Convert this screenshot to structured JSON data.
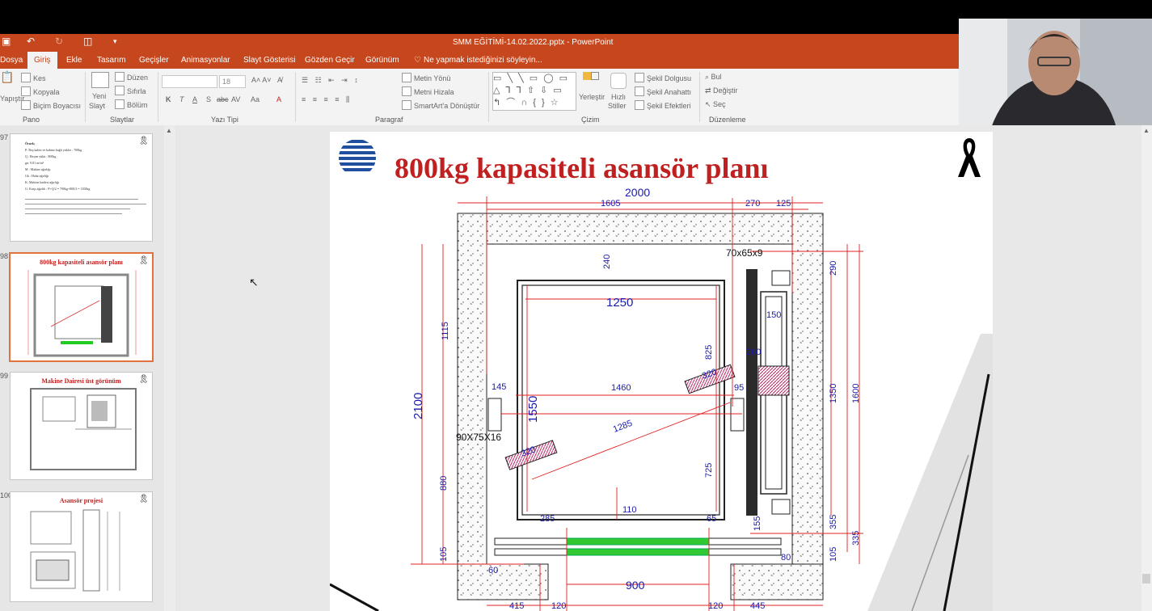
{
  "window": {
    "title": "SMM EĞİTİMİ-14.02.2022.pptx - PowerPoint"
  },
  "tabs": [
    "Dosya",
    "Giriş",
    "Ekle",
    "Tasarım",
    "Geçişler",
    "Animasyonlar",
    "Slayt Gösterisi",
    "Gözden Geçir",
    "Görünüm"
  ],
  "tell_me": "Ne yapmak istediğinizi söyleyin...",
  "ribbon": {
    "pano": {
      "paste": "Yapıştır",
      "cut": "Kes",
      "copy": "Kopyala",
      "format_painter": "Biçim Boyacısı",
      "label": "Pano"
    },
    "slaytlar": {
      "new_slide_1": "Yeni",
      "new_slide_2": "Slayt",
      "layout": "Düzen",
      "reset": "Sıfırla",
      "section": "Bölüm",
      "label": "Slaytlar"
    },
    "yazi": {
      "font_size": "18",
      "label": "Yazı Tipi",
      "bold": "K",
      "italic": "T",
      "underline": "A",
      "shadow": "S",
      "strike": "abc"
    },
    "paragraf": {
      "text_direction": "Metin Yönü",
      "align_text": "Metni Hizala",
      "smartart": "SmartArt'a Dönüştür",
      "label": "Paragraf"
    },
    "cizim": {
      "arrange": "Yerleştir",
      "quick_1": "Hızlı",
      "quick_2": "Stiller",
      "fill": "Şekil Dolgusu",
      "outline": "Şekil Anahattı",
      "effects": "Şekil Efektleri",
      "label": "Çizim"
    },
    "duzenleme": {
      "find": "Bul",
      "replace": "Değiştir",
      "select": "Seç",
      "label": "Düzenleme"
    }
  },
  "thumbnails": [
    {
      "num": "97",
      "title": "",
      "text": [
        "Örnek;",
        "P: Boş kabin ve kabine bağlı yükler : 700kg",
        "Q : Beyan yükü : 800kg",
        "gn: 9.81 m/sn²",
        "M : Makine ağırlığı",
        "Gk : Halat ağırlığı",
        "K: Makine kaidesi ağırlığı",
        "G: Karşı ağırlık : P+Q/2 = 700kg+800/2 = 1100kg"
      ]
    },
    {
      "num": "98",
      "title": "800kg kapasiteli asansör planı",
      "selected": true
    },
    {
      "num": "99",
      "title": "Makine Dairesi üst görünüm"
    },
    {
      "num": "100",
      "title": "Asansör projesi"
    }
  ],
  "slide": {
    "title": "800kg kapasiteli asansör planı",
    "dims": {
      "d2000": "2000",
      "d1605": "1605",
      "d270": "270",
      "d125": "125",
      "d240": "240",
      "d70x65": "70x65x9",
      "d290": "290",
      "d1250": "1250",
      "d150": "150",
      "d1115": "1115",
      "d825": "825",
      "d260": "260",
      "d320a": "320",
      "d145": "145",
      "d1460": "1460",
      "d95": "95",
      "d1350": "1350",
      "d1600": "1600",
      "d2100": "2100",
      "d1550": "1550",
      "d1285": "1285",
      "d90x75": "90X75X16",
      "d320b": "320",
      "d880": "880",
      "d725": "725",
      "d110": "110",
      "d285": "285",
      "d65": "65",
      "d155": "155",
      "d355": "355",
      "d335": "335",
      "d105a": "105",
      "d105b": "105",
      "d60": "60",
      "d80": "80",
      "d900": "900",
      "d415": "415",
      "d120a": "120",
      "d120b": "120",
      "d445": "445"
    }
  },
  "colors": {
    "accent": "#c6461d",
    "title_red": "#c0201f",
    "dim_blue": "#1a1aaa",
    "dim_red": "#e02020"
  }
}
